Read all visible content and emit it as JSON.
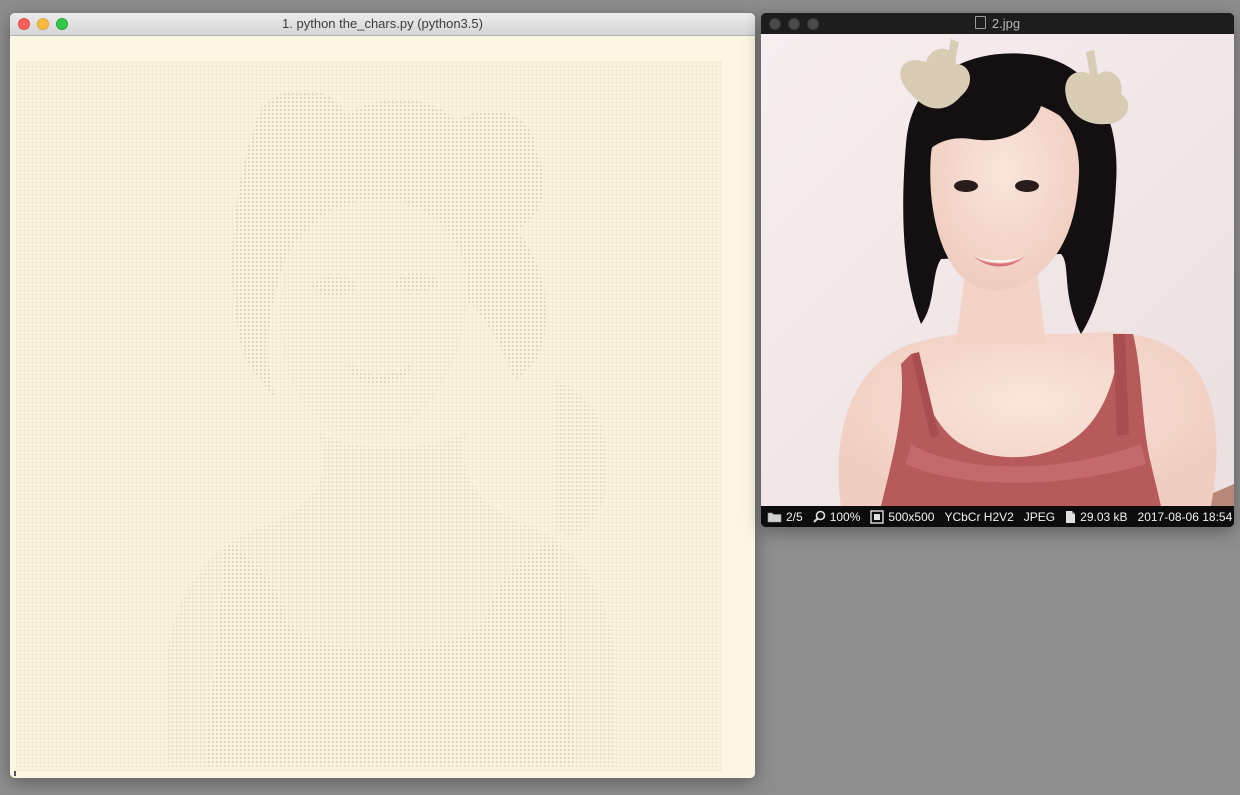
{
  "terminal": {
    "title": "1. python the_chars.py (python3.5)"
  },
  "viewer": {
    "title": "2.jpg",
    "status": {
      "position": "2/5",
      "zoom": "100%",
      "dimensions": "500x500",
      "color_space": "YCbCr H2V2",
      "format": "JPEG",
      "file_size": "29.03 kB",
      "timestamp": "2017-08-06 18:54"
    }
  },
  "colors": {
    "terminal_bg": "#fdf6e3",
    "desktop_bg": "#8e8e8e",
    "close": "#fc605b",
    "minimize": "#fdbc40",
    "zoom": "#34c84a"
  }
}
